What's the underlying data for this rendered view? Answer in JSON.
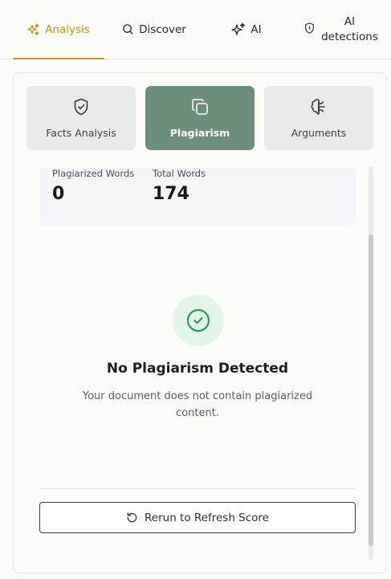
{
  "tabs": {
    "analysis": "Analysis",
    "discover": "Discover",
    "ai": "AI",
    "ai_detections_line1": "AI",
    "ai_detections_line2": "detections"
  },
  "segments": {
    "facts": "Facts Analysis",
    "plagiarism": "Plagiarism",
    "arguments": "Arguments"
  },
  "stats": {
    "plagiarized_label": "Plagiarized Words",
    "plagiarized_value": "0",
    "total_label": "Total Words",
    "total_value": "174"
  },
  "result": {
    "title": "No Plagiarism Detected",
    "description": "Your document does not contain plagiarized content."
  },
  "actions": {
    "rerun": "Rerun to Refresh Score"
  },
  "colors": {
    "accent": "#c9962a",
    "active_segment": "#6b8f7a",
    "success": "#2e9a52"
  }
}
